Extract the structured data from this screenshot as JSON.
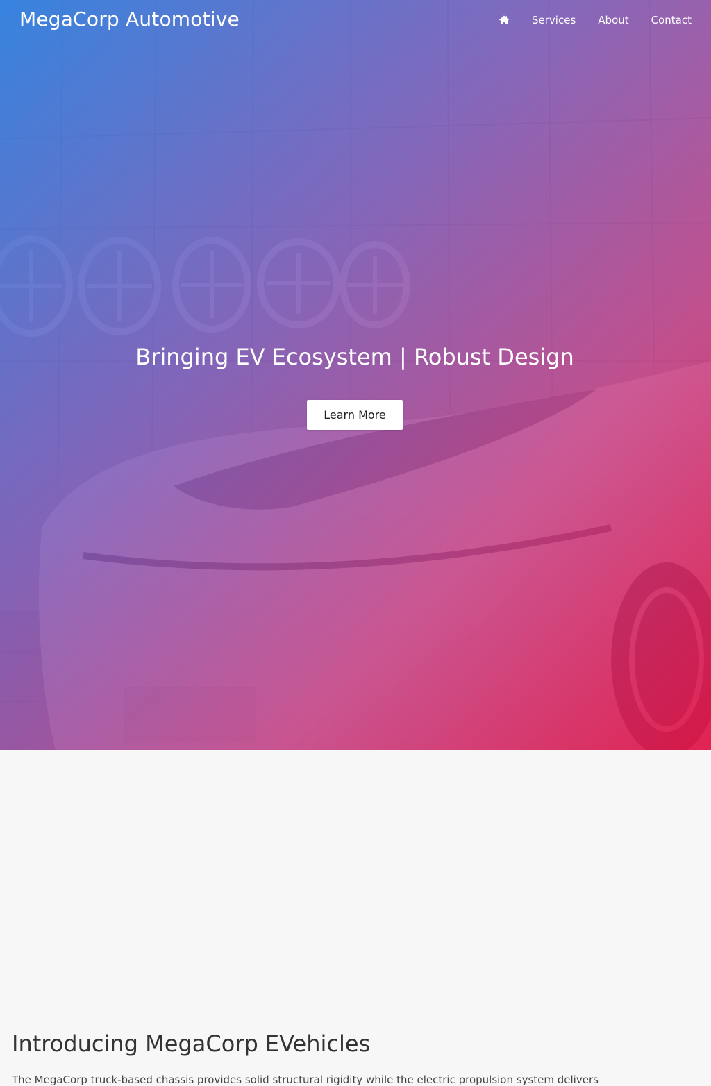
{
  "nav": {
    "brand": "MegaCorp Automotive",
    "home_icon": "home-icon",
    "links": [
      "Services",
      "About",
      "Contact"
    ]
  },
  "hero": {
    "title": "Bringing EV Ecosystem | Robust Design",
    "button_label": "Learn More"
  },
  "intro": {
    "heading": "Introducing MegaCorp EVehicles",
    "body": "The MegaCorp truck-based chassis provides solid structural rigidity while the electric propulsion system delivers"
  },
  "colors": {
    "gradient_start": "#2a7ee0",
    "gradient_mid": "#7454b8",
    "gradient_end": "#e2143f",
    "page_background": "#f7f7f7",
    "heading_text": "#333333"
  }
}
